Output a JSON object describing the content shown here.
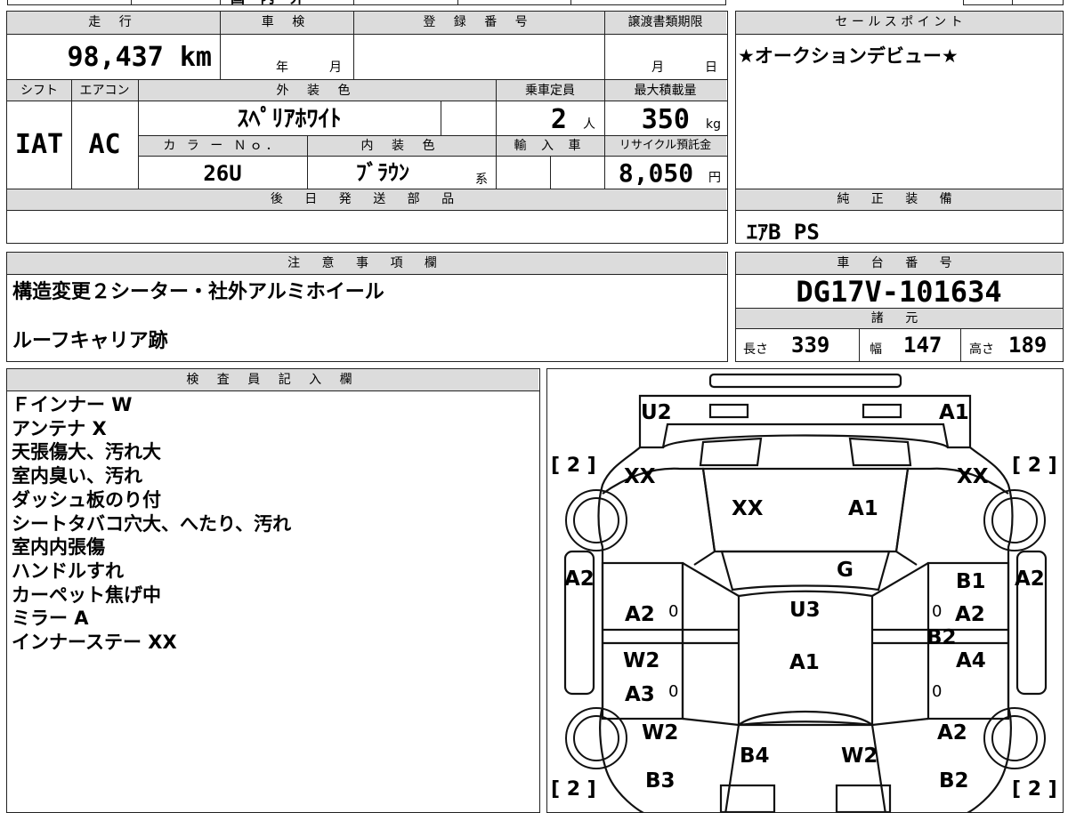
{
  "top_strip": {
    "fragment": "国 内 外"
  },
  "vehicle": {
    "mileage_label": "走 行",
    "mileage_value": "98,437",
    "mileage_unit": "km",
    "inspection_label": "車 検",
    "inspection_year": "年",
    "inspection_month": "月",
    "registration_label": "登 録 番 号",
    "registration_value": "",
    "transfer_label": "譲渡書類期限",
    "transfer_month": "月",
    "transfer_day": "日",
    "shift_label": "シフト",
    "shift_value": "IAT",
    "ac_label": "エアコン",
    "ac_value": "AC",
    "exterior_label": "外 装 色",
    "exterior_value": "ｽﾍﾟﾘｱﾎﾜｲﾄ",
    "color_no_label": "カ ラ ー Ｎｏ．",
    "color_no_value": "26U",
    "interior_label": "内 装 色",
    "interior_value": "ﾌﾞﾗｳﾝ",
    "interior_suffix": "系",
    "capacity_label": "乗車定員",
    "capacity_value": "2",
    "capacity_unit": "人",
    "max_load_label": "最大積載量",
    "max_load_value": "350",
    "max_load_unit": "kg",
    "import_label": "輸 入 車",
    "recycle_label": "リサイクル預託金",
    "recycle_value": "8,050",
    "recycle_unit": "円",
    "later_parts_label": "後 日 発 送 部 品"
  },
  "sales_point": {
    "label": "セ ー ル ス ポ イ ン ト",
    "text": "★オークションデビュー★"
  },
  "genuine_equipment": {
    "label": "純 正 装 備",
    "text": "ｴｱB PS"
  },
  "notes": {
    "label": "注 意 事 項 欄",
    "lines": [
      "構造変更２シーター・社外アルミホイール",
      "ルーフキャリア跡"
    ]
  },
  "chassis": {
    "label": "車 台 番 号",
    "value": "DG17V-101634",
    "specs_label": "諸 元",
    "length_label": "長さ",
    "length_value": "339",
    "width_label": "幅",
    "width_value": "147",
    "height_label": "高さ",
    "height_value": "189"
  },
  "inspector": {
    "label": "検 査 員 記 入 欄",
    "lines": [
      "Ｆインナー W",
      "アンテナ X",
      "天張傷大、汚れ大",
      "室内臭い、汚れ",
      "ダッシュ板のり付",
      "シートタバコ穴大、へたり、汚れ",
      "室内内張傷",
      "ハンドルすれ",
      "カーペット焦げ中",
      "ミラー A",
      "インナーステー XX"
    ]
  },
  "diagram": {
    "tire_marks": [
      "[ 2 ]",
      "[ 2 ]",
      "[ 2 ]",
      "[ 2 ]"
    ],
    "labels": {
      "front_left": "U2",
      "front_right": "A1",
      "fender_left": "XX",
      "fender_right": "XX",
      "hood_left": "XX",
      "hood_right": "A1",
      "windshield": "G",
      "side_left_front": "A2",
      "side_right_front": "A2",
      "door_left_front": "A2",
      "door_right_front_top": "B1",
      "door_right_front": "A2",
      "door_right_front_b": "B2",
      "roof": "U3",
      "roof_center": "A1",
      "door_left_rear_w": "W2",
      "door_left_rear": "A3",
      "door_right_rear": "A4",
      "rear_left_fender": "W2",
      "rear_right_fender": "A2",
      "rear_left_corner": "B3",
      "rear_right_corner": "B2",
      "tailgate_left": "B4",
      "tailgate_right": "W2"
    },
    "zero_marks": [
      "0",
      "0",
      "0",
      "0"
    ]
  }
}
